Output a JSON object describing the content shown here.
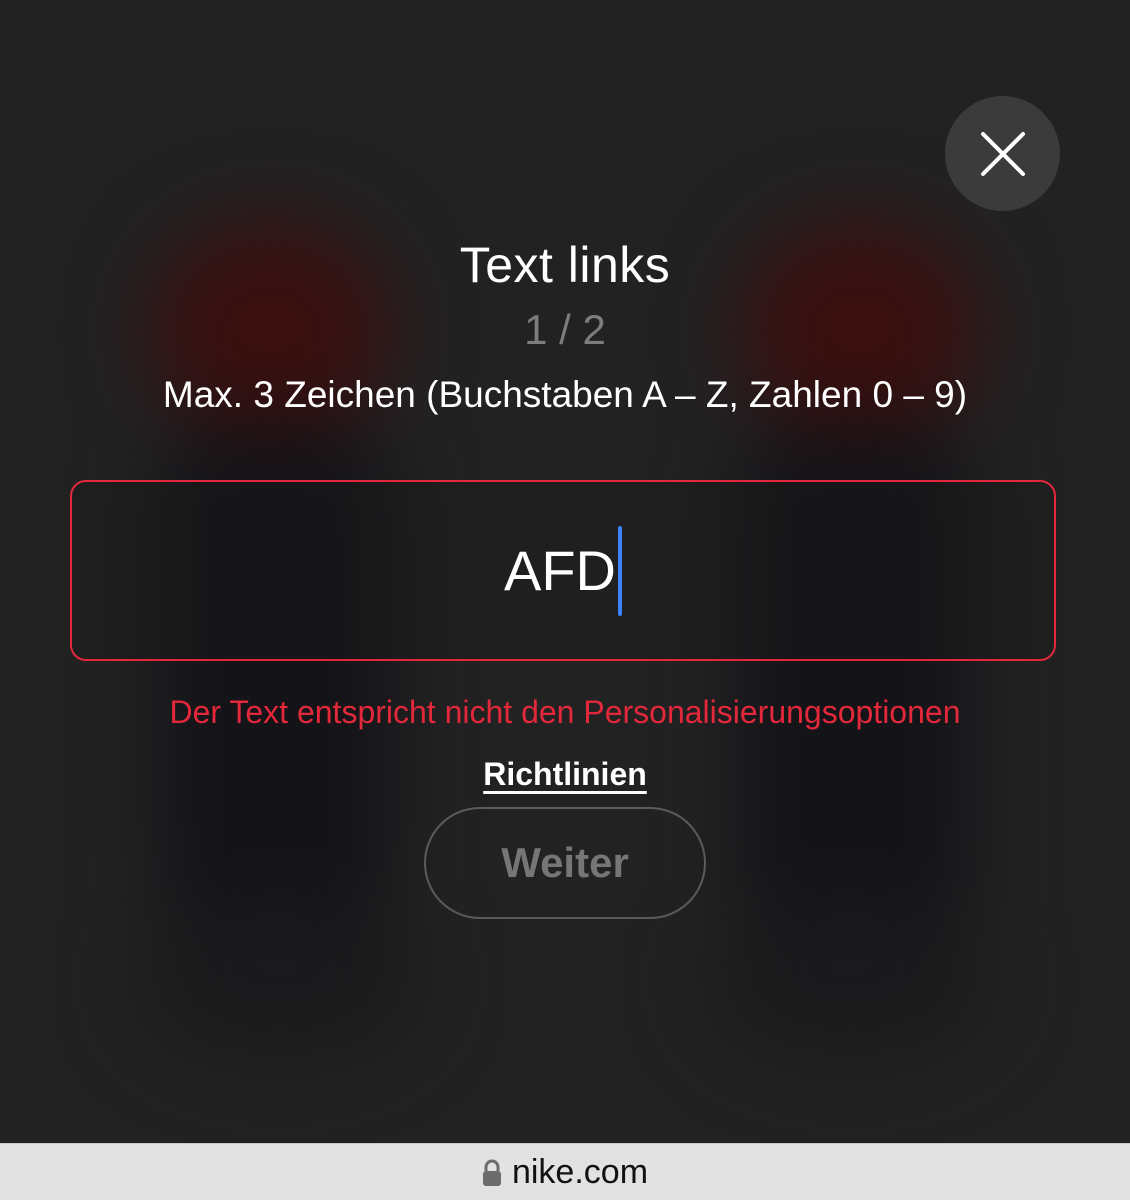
{
  "dialog": {
    "title": "Text links",
    "step": "1 / 2",
    "hint": "Max. 3 Zeichen (Buchstaben A – Z, Zahlen 0 – 9)",
    "input_value": "AFD",
    "error_message": "Der Text entspricht nicht den Personalisierungsoptionen",
    "guidelines_link": "Richtlinien",
    "next_button": "Weiter",
    "close_icon": "close-icon"
  },
  "browser": {
    "url": "nike.com",
    "lock_icon": "lock-icon"
  },
  "colors": {
    "background": "#222223",
    "error": "#e2283a",
    "caret": "#3b82f6",
    "url_bar": "#e2e2e2"
  }
}
